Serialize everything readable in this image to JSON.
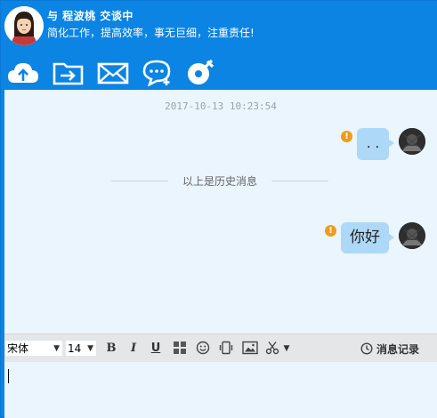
{
  "header": {
    "title": "与  程波桃  交谈中",
    "subtitle": "简化工作，提高效率，事无巨细，注重责任!"
  },
  "toolbar": {
    "items": [
      {
        "name": "upload",
        "icon": "cloud-upload-icon"
      },
      {
        "name": "folder-transfer",
        "icon": "folder-transfer-icon"
      },
      {
        "name": "mail",
        "icon": "mail-icon"
      },
      {
        "name": "new-chat",
        "icon": "chat-add-icon"
      },
      {
        "name": "settings",
        "icon": "gear-wrench-icon"
      }
    ]
  },
  "chat": {
    "timestamp": "2017-10-13 10:23:54",
    "history_separator": "以上是历史消息",
    "messages": [
      {
        "text": ". .",
        "status": "!"
      },
      {
        "text": "你好",
        "status": "!"
      }
    ]
  },
  "format_bar": {
    "font_family": "宋体",
    "font_size": "14",
    "bold": "B",
    "italic": "I",
    "underline": "U",
    "history_label": "消息记录"
  },
  "input": {
    "value": ""
  },
  "colors": {
    "header_bg": "#0b84e4",
    "chat_bg": "#eaf5fd",
    "bubble": "#aed8f7",
    "warning": "#f39a16"
  }
}
